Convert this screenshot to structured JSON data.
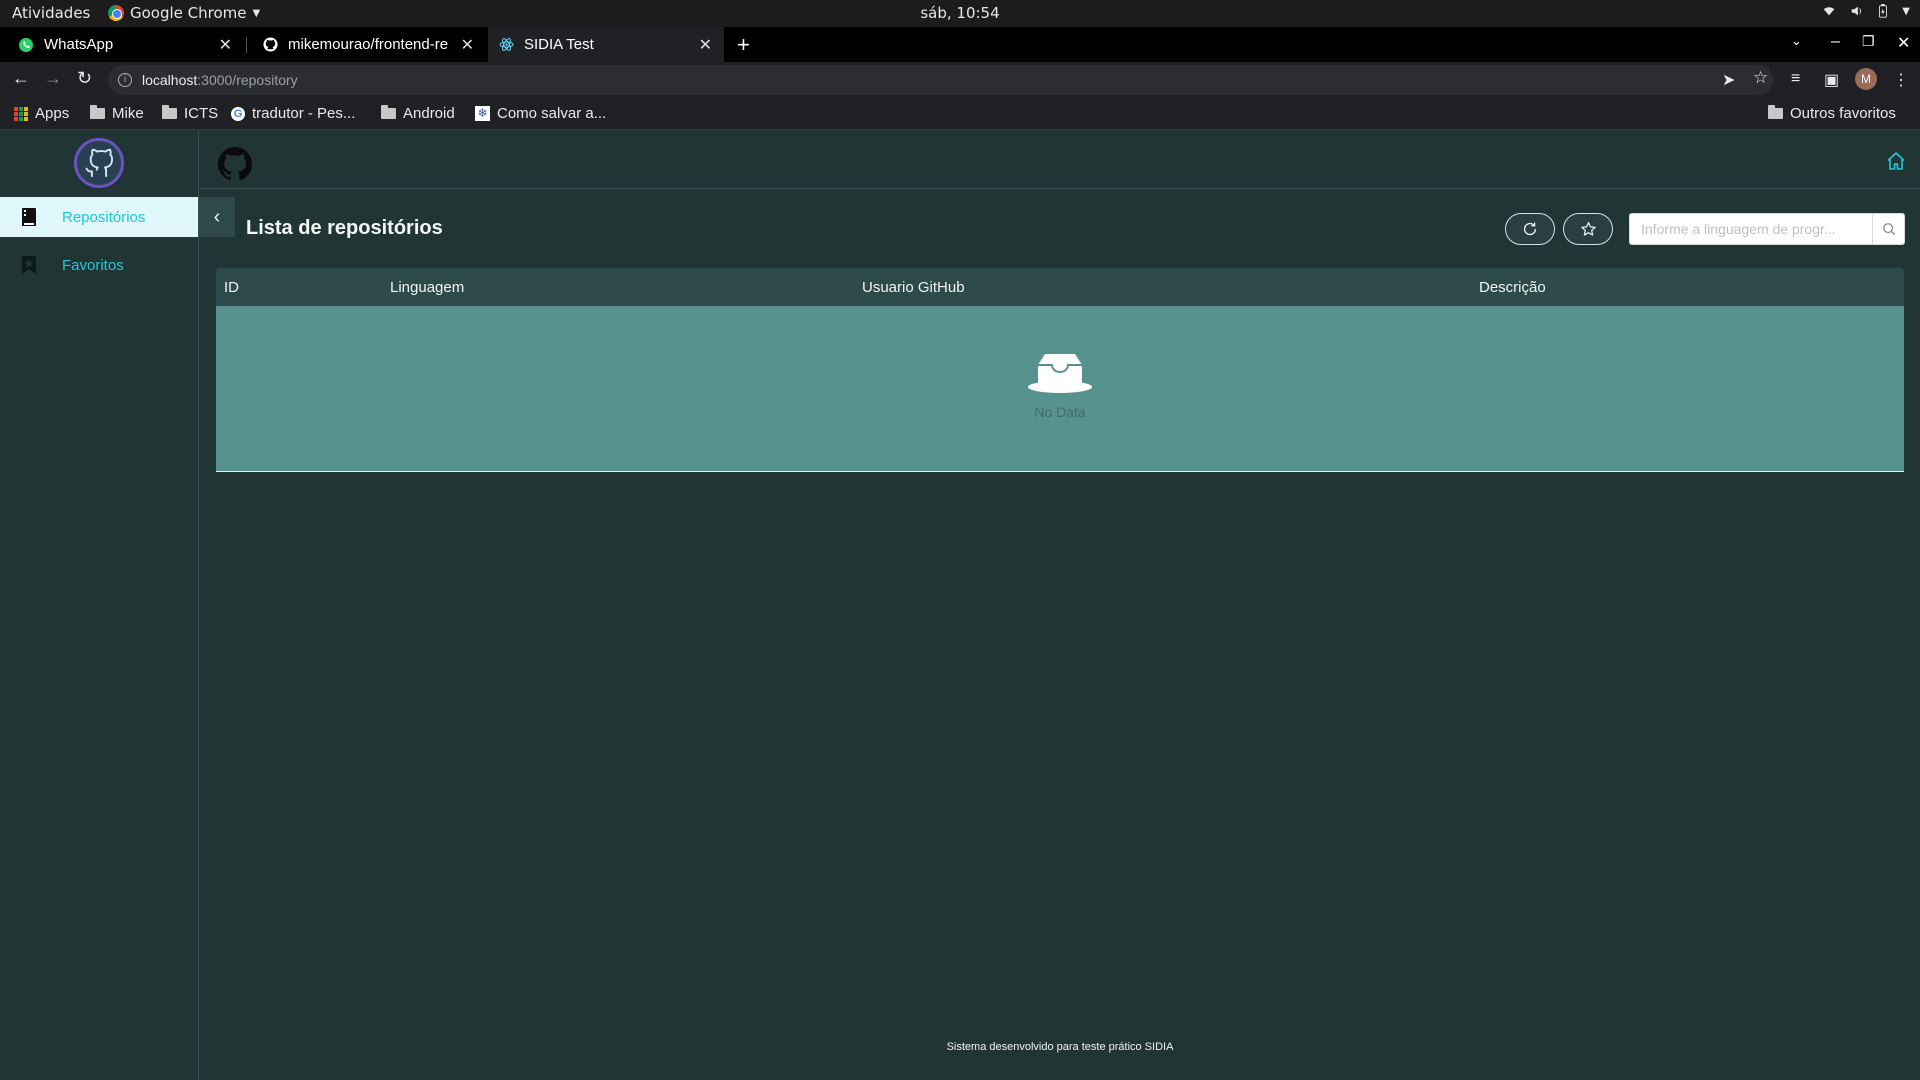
{
  "os_bar": {
    "activities": "Atividades",
    "app_name": "Google Chrome",
    "clock": "sáb, 10:54"
  },
  "tabs": [
    {
      "title": "WhatsApp",
      "icon": "whatsapp-icon"
    },
    {
      "title": "mikemourao/frontend-re",
      "icon": "github-icon"
    },
    {
      "title": "SIDIA Test",
      "icon": "react-icon"
    }
  ],
  "address_bar": {
    "host": "localhost",
    "path": ":3000/repository"
  },
  "bookmarks": {
    "items": [
      "Apps",
      "Mike",
      "ICTS",
      "tradutor - Pes...",
      "Android",
      "Como salvar a..."
    ],
    "other": "Outros favoritos"
  },
  "profile_initial": "M",
  "sidebar": {
    "items": [
      {
        "label": "Repositórios",
        "icon": "repo-book-icon",
        "active": true
      },
      {
        "label": "Favoritos",
        "icon": "bookmark-star-icon",
        "active": false
      }
    ]
  },
  "main": {
    "title": "Lista de repositórios",
    "search": {
      "placeholder": "Informe a linguagem de progr..."
    },
    "table": {
      "columns": [
        "ID",
        "Linguagem",
        "Usuario GitHub",
        "Descrição"
      ],
      "rows": [],
      "empty_text": "No Data"
    }
  },
  "footer": "Sistema desenvolvido para teste prático SIDIA",
  "colors": {
    "accent": "#1ec8d9",
    "background": "#223535",
    "table_header": "#2e4a4a",
    "table_body": "#58928e"
  }
}
